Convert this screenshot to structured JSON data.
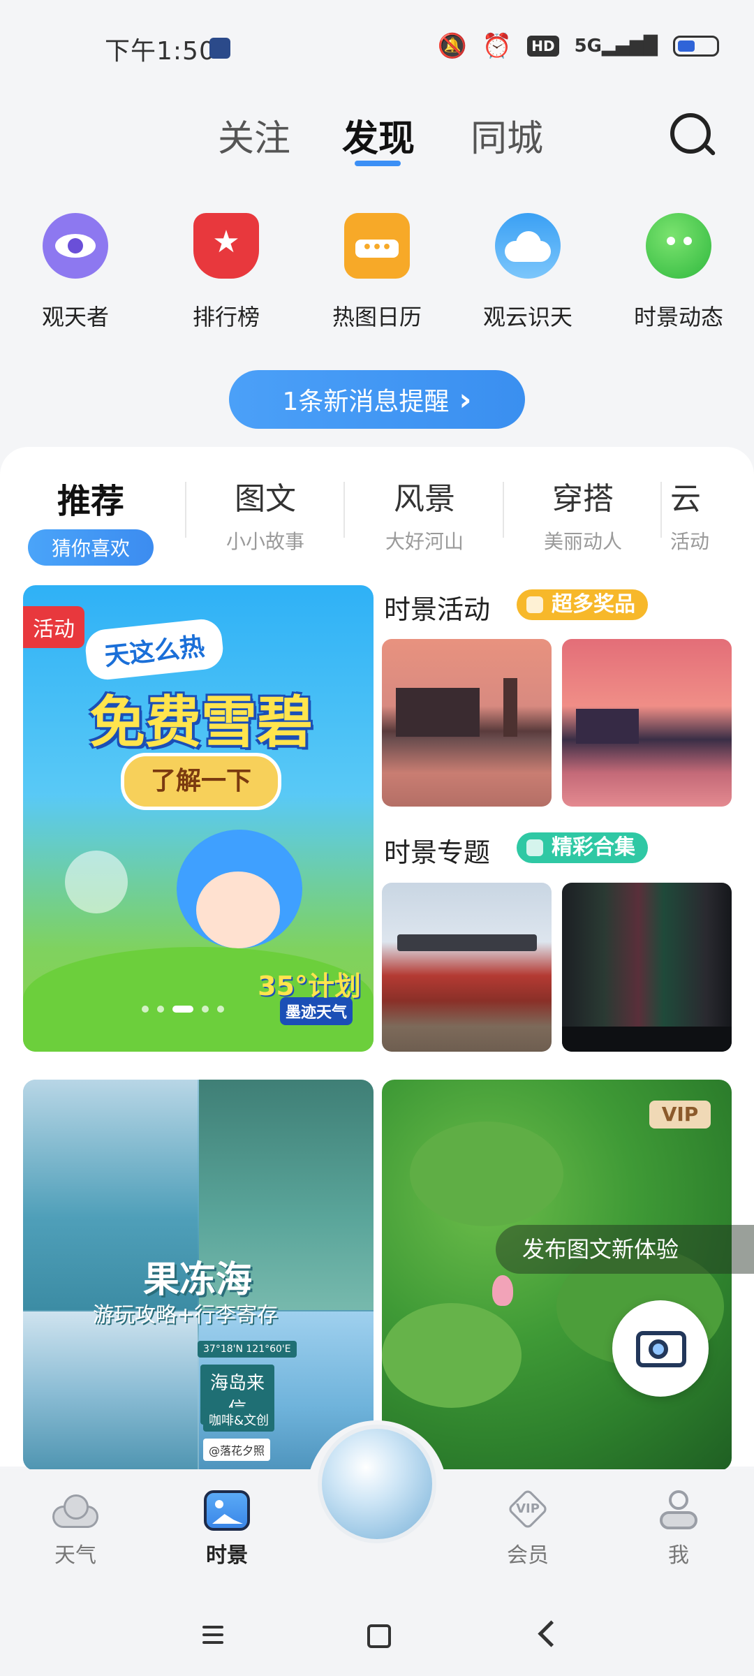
{
  "status": {
    "time": "下午1:50",
    "icons": [
      "mute-bell-icon",
      "alarm-icon",
      "hd-icon",
      "signal-5g-icon",
      "battery-icon"
    ],
    "hd": "HD",
    "net": "5G"
  },
  "top_tabs": [
    {
      "label": "关注"
    },
    {
      "label": "发现"
    },
    {
      "label": "同城"
    }
  ],
  "shortcuts": [
    {
      "label": "观天者",
      "icon": "eye-icon",
      "color": "#8d78f0"
    },
    {
      "label": "排行榜",
      "icon": "trophy-icon",
      "color": "#e8383d"
    },
    {
      "label": "热图日历",
      "icon": "calendar-icon",
      "color": "#f7a928"
    },
    {
      "label": "观云识天",
      "icon": "cloud-icon",
      "color": "#3aa0f4"
    },
    {
      "label": "时景动态",
      "icon": "planet-icon",
      "color": "#3cc94a"
    }
  ],
  "notice": {
    "label": "1条新消息提醒",
    "arrow": "›"
  },
  "categories": [
    {
      "title": "推荐",
      "sub": "猜你喜欢"
    },
    {
      "title": "图文",
      "sub": "小小故事"
    },
    {
      "title": "风景",
      "sub": "大好河山"
    },
    {
      "title": "穿搭",
      "sub": "美丽动人"
    },
    {
      "title": "云",
      "sub": "活动"
    }
  ],
  "banner": {
    "tag": "活动",
    "sub": "天这么热",
    "title": "免费雪碧",
    "cta": "了解一下",
    "logo": "墨迹天气",
    "badge": "35°计划"
  },
  "activity": {
    "title": "时景活动",
    "pill": "超多奖品",
    "pill_color": "#f7b82a"
  },
  "topic": {
    "title": "时景专题",
    "pill": "精彩合集",
    "pill_color": "#2fc8a4"
  },
  "feed_card1": {
    "title": "果冻海",
    "sub": "游玩攻略+行李寄存",
    "sign1": "海岛来信",
    "sign2": "咖啡&文创",
    "sign3": "@落花夕照",
    "coords": "37°18'N 121°60'E"
  },
  "feed_card2": {
    "vip": "VIP",
    "tip": "发布图文新体验"
  },
  "bottom_nav": [
    {
      "label": "天气",
      "icon": "cloud-weather-icon"
    },
    {
      "label": "时景",
      "icon": "photo-icon"
    },
    {
      "label": "会员",
      "icon": "vip-icon"
    },
    {
      "label": "我",
      "icon": "user-icon"
    }
  ]
}
